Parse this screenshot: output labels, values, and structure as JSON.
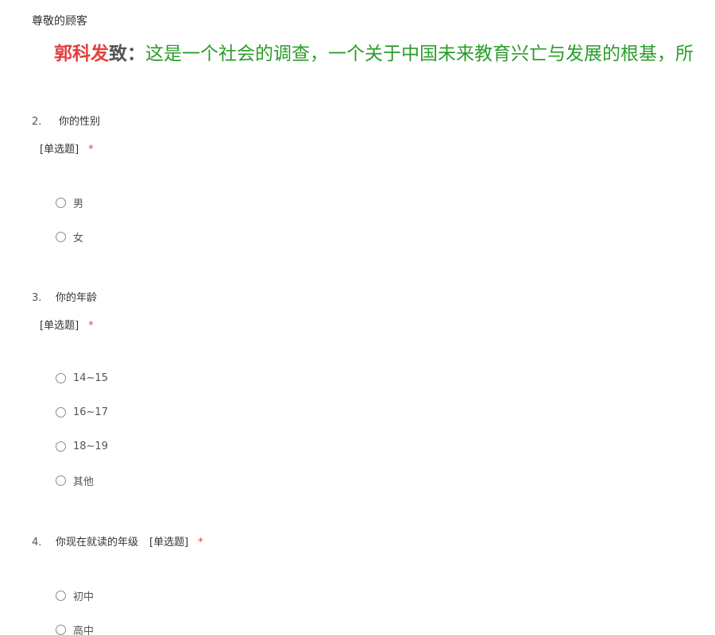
{
  "greeting": "尊敬的顾客",
  "banner": {
    "name": "郭科发",
    "zhi": "致",
    "colon": "：",
    "message": "这是一个社会的调查，一个关于中国未来教育兴亡与发展的根基，所"
  },
  "questions": [
    {
      "number": "2.",
      "title": "你的性别",
      "type": "[单选题]",
      "required": "*",
      "options": [
        "男",
        "女"
      ]
    },
    {
      "number": "3.",
      "title": "你的年龄",
      "type": "[单选题]",
      "required": "*",
      "options": [
        "14~15",
        "16~17",
        "18~19",
        "其他"
      ]
    },
    {
      "number": "4.",
      "title": "你现在就读的年级",
      "type": "[单选题]",
      "required": "*",
      "options": [
        "初中",
        "高中"
      ]
    }
  ]
}
